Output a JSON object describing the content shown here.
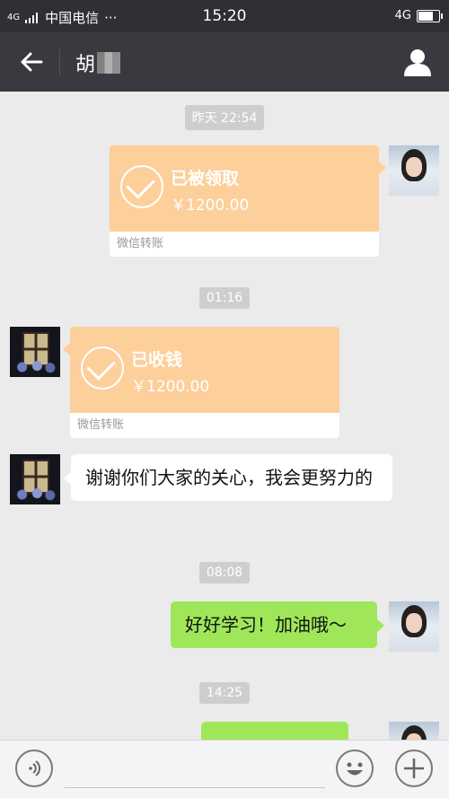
{
  "status_bar": {
    "signal": "4G",
    "carrier": "中国电信",
    "dots": "···",
    "time": "15:20",
    "network": "4G"
  },
  "header": {
    "back_icon": "arrow-left-icon",
    "contact_name": "胡",
    "profile_icon": "person-icon"
  },
  "messages": {
    "ts1": "昨天 22:54",
    "transfer1": {
      "status": "已被领取",
      "amount": "￥1200.00",
      "label": "微信转账"
    },
    "ts2": "01:16",
    "transfer2": {
      "status": "已收钱",
      "amount": "￥1200.00",
      "label": "微信转账"
    },
    "text1": "谢谢你们大家的关心，我会更努力的",
    "ts3": "08:08",
    "text2": "好好学习！加油哦～",
    "ts4": "14:25"
  },
  "input_bar": {
    "voice_icon": "voice-icon",
    "emoji_icon": "emoji-icon",
    "plus_icon": "plus-icon"
  },
  "colors": {
    "transfer_orange": "#fdcf9b",
    "sent_green": "#9fe759",
    "header_dark": "#393a3f"
  }
}
